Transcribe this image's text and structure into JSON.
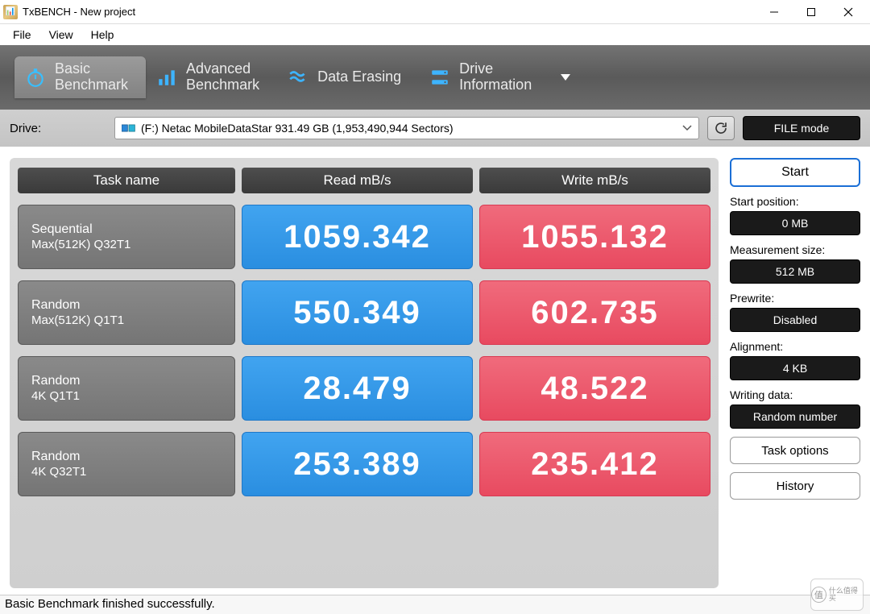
{
  "window": {
    "title": "TxBENCH - New project"
  },
  "menu": {
    "file": "File",
    "view": "View",
    "help": "Help"
  },
  "tabs": {
    "basic": {
      "l1": "Basic",
      "l2": "Benchmark"
    },
    "advanced": {
      "l1": "Advanced",
      "l2": "Benchmark"
    },
    "erasing": {
      "l1": "Data Erasing",
      "l2": ""
    },
    "drive": {
      "l1": "Drive",
      "l2": "Information"
    }
  },
  "drive_row": {
    "label": "Drive:",
    "value": "(F:) Netac MobileDataStar  931.49 GB (1,953,490,944 Sectors)",
    "file_mode": "FILE mode"
  },
  "headers": {
    "task": "Task name",
    "read": "Read mB/s",
    "write": "Write mB/s"
  },
  "rows": [
    {
      "name": "Sequential",
      "sub": "Max(512K) Q32T1",
      "read": "1059.342",
      "write": "1055.132"
    },
    {
      "name": "Random",
      "sub": "Max(512K) Q1T1",
      "read": "550.349",
      "write": "602.735"
    },
    {
      "name": "Random",
      "sub": "4K Q1T1",
      "read": "28.479",
      "write": "48.522"
    },
    {
      "name": "Random",
      "sub": "4K Q32T1",
      "read": "253.389",
      "write": "235.412"
    }
  ],
  "side": {
    "start": "Start",
    "start_pos_label": "Start position:",
    "start_pos": "0 MB",
    "meas_size_label": "Measurement size:",
    "meas_size": "512 MB",
    "prewrite_label": "Prewrite:",
    "prewrite": "Disabled",
    "alignment_label": "Alignment:",
    "alignment": "4 KB",
    "writing_data_label": "Writing data:",
    "writing_data": "Random number",
    "task_options": "Task options",
    "history": "History"
  },
  "status": "Basic Benchmark finished successfully.",
  "watermark": "什么值得买"
}
